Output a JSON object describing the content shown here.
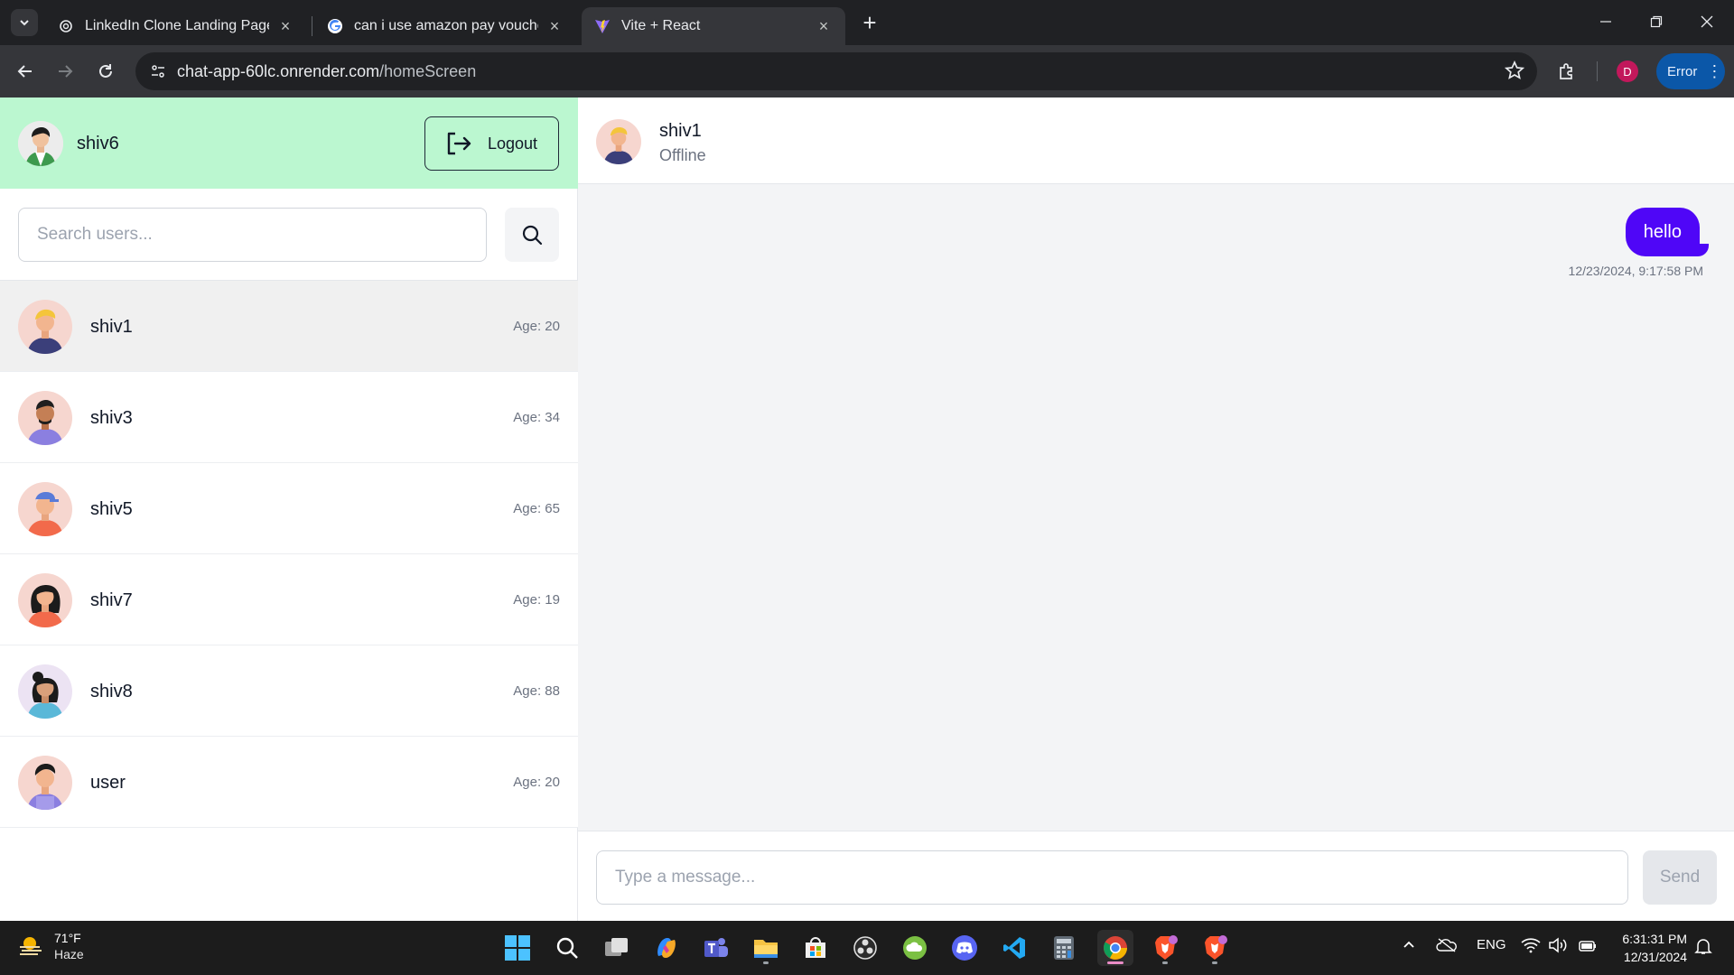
{
  "browser": {
    "tabs": [
      {
        "title": "LinkedIn Clone Landing Page",
        "active": false
      },
      {
        "title": "can i use amazon pay voucher f",
        "active": false
      },
      {
        "title": "Vite + React",
        "active": true
      }
    ],
    "url_host": "chat-app-60lc.onrender.com",
    "url_path": "/homeScreen",
    "profile_initial": "D",
    "error_label": "Error"
  },
  "sidebar": {
    "me_name": "shiv6",
    "logout_label": "Logout",
    "search_placeholder": "Search users...",
    "users": [
      {
        "name": "shiv1",
        "age": "Age: 20",
        "selected": true
      },
      {
        "name": "shiv3",
        "age": "Age: 34",
        "selected": false
      },
      {
        "name": "shiv5",
        "age": "Age: 65",
        "selected": false
      },
      {
        "name": "shiv7",
        "age": "Age: 19",
        "selected": false
      },
      {
        "name": "shiv8",
        "age": "Age: 88",
        "selected": false
      },
      {
        "name": "user",
        "age": "Age: 20",
        "selected": false
      }
    ]
  },
  "chat": {
    "name": "shiv1",
    "status": "Offline",
    "messages": [
      {
        "text": "hello",
        "time": "12/23/2024, 9:17:58 PM",
        "mine": true
      }
    ],
    "input_placeholder": "Type a message...",
    "send_label": "Send"
  },
  "taskbar": {
    "weather_temp": "71°F",
    "weather_desc": "Haze",
    "language": "ENG",
    "time": "6:31:31 PM",
    "date": "12/31/2024"
  },
  "colors": {
    "header_green": "#bbf7d0",
    "bubble_purple": "#4f06f7",
    "error_blue": "#0b57a8"
  }
}
